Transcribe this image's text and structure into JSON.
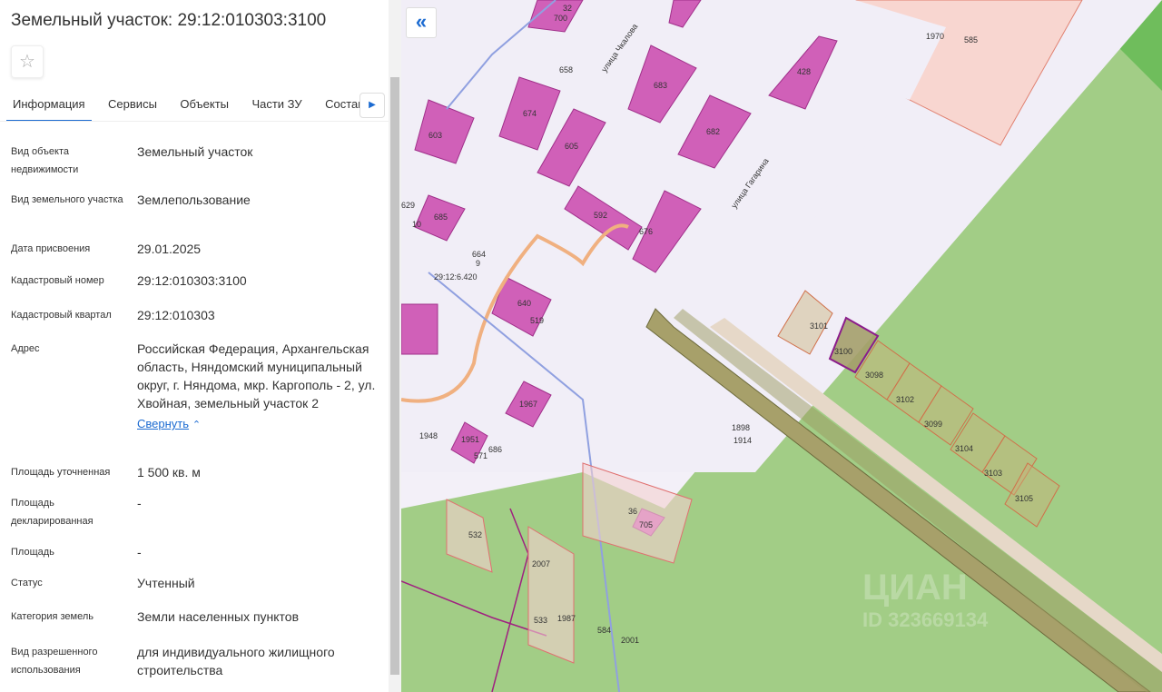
{
  "panel": {
    "title": "Земельный участок: 29:12:010303:3100",
    "tabs": [
      "Информация",
      "Сервисы",
      "Объекты",
      "Части ЗУ",
      "Состав"
    ],
    "fields": [
      {
        "label": "Вид объекта недвижимости",
        "value": "Земельный участок"
      },
      {
        "label": "Вид земельного участка",
        "value": "Землепользование"
      },
      {
        "label": "Дата присвоения",
        "value": "29.01.2025"
      },
      {
        "label": "Кадастровый номер",
        "value": "29:12:010303:3100"
      },
      {
        "label": "Кадастровый квартал",
        "value": "29:12:010303"
      },
      {
        "label": "Адрес",
        "value": "Российская Федерация, Архангельская область, Няндомский муниципальный округ, г. Няндома, мкр. Каргополь - 2, ул. Хвойная, земельный участок 2"
      },
      {
        "label": "Площадь уточненная",
        "value": "1 500 кв. м"
      },
      {
        "label": "Площадь декларированная",
        "value": "-"
      },
      {
        "label": "Площадь",
        "value": "-"
      },
      {
        "label": "Статус",
        "value": "Учтенный"
      },
      {
        "label": "Категория земель",
        "value": "Земли населенных пунктов"
      },
      {
        "label": "Вид разрешенного использования",
        "value": "для индивидуального жилищного строительства"
      }
    ],
    "collapse_label": "Свернуть"
  },
  "map": {
    "streets": [
      "улица Чкалова",
      "улица Гагарина"
    ],
    "parcels": [
      "3101",
      "3100",
      "3098",
      "3102",
      "3099",
      "3104",
      "3103",
      "3105",
      "1898",
      "1914",
      "603",
      "674",
      "605",
      "683",
      "682",
      "428",
      "592",
      "676",
      "685",
      "664",
      "640",
      "519",
      "1967",
      "1951",
      "686",
      "571",
      "1948",
      "532",
      "2007",
      "533",
      "1987",
      "584",
      "2001",
      "705",
      "36",
      "700",
      "32",
      "658",
      "629",
      "10",
      "9",
      "1970",
      "585",
      "29:12:6.420"
    ],
    "watermark": "ЦИАН",
    "watermark_id": "ID 323669134"
  }
}
